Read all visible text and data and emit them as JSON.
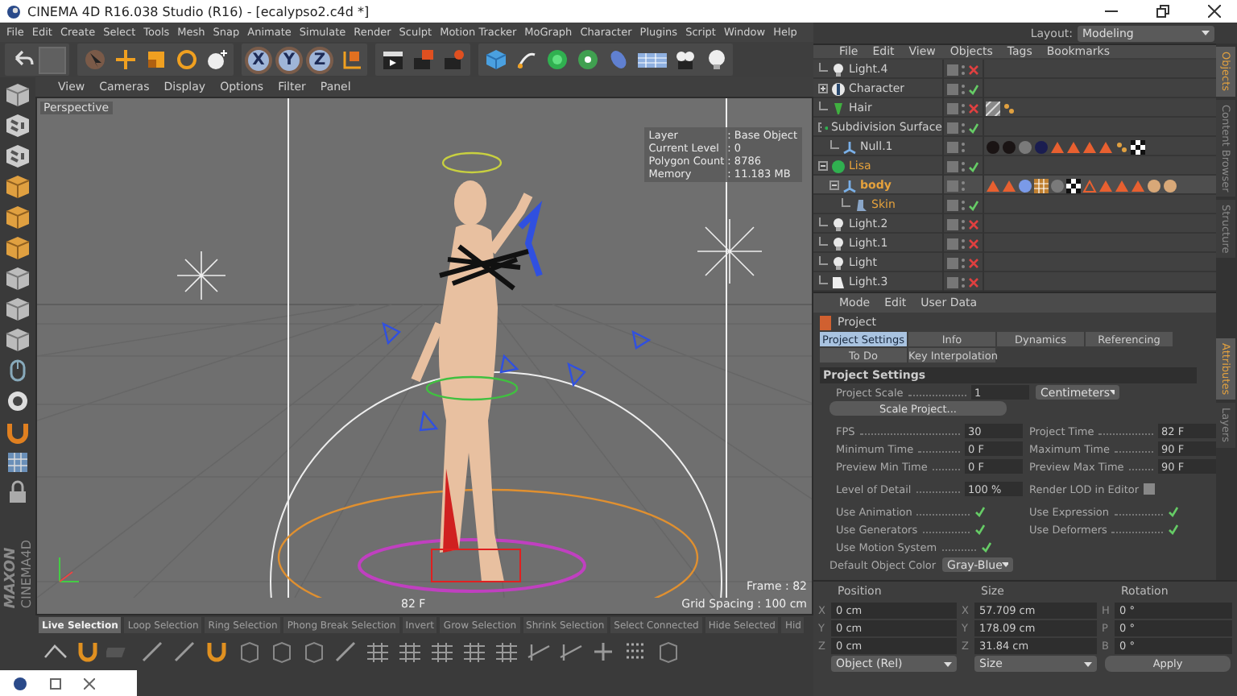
{
  "window": {
    "title": "CINEMA 4D R16.038 Studio (R16) - [ecalypso2.c4d *]"
  },
  "menu": [
    "File",
    "Edit",
    "Create",
    "Select",
    "Tools",
    "Mesh",
    "Snap",
    "Animate",
    "Simulate",
    "Render",
    "Sculpt",
    "Motion Tracker",
    "MoGraph",
    "Character",
    "Plugins",
    "Script",
    "Window",
    "Help"
  ],
  "toolbar": {
    "axis_buttons": [
      {
        "label": "X",
        "selected": true
      },
      {
        "label": "Y",
        "selected": true
      },
      {
        "label": "Z",
        "selected": true
      }
    ]
  },
  "layout": {
    "label": "Layout:",
    "value": "Modeling"
  },
  "viewport": {
    "menu": [
      "View",
      "Cameras",
      "Display",
      "Options",
      "Filter",
      "Panel"
    ],
    "camera": "Perspective",
    "hud": [
      {
        "label": "Layer",
        "value": ": Base Object"
      },
      {
        "label": "Current Level",
        "value": ": 0"
      },
      {
        "label": "Polygon Count",
        "value": ": 8786"
      },
      {
        "label": "Memory",
        "value": ": 11.183 MB"
      }
    ],
    "frame_marker": "82 F",
    "frame": "Frame : 82",
    "grid_spacing": "Grid Spacing : 100 cm"
  },
  "logo": {
    "brand": "MAXON",
    "product": "CINEMA4D"
  },
  "selection_tabs": [
    {
      "label": "Live Selection",
      "selected": true
    },
    {
      "label": "Loop Selection",
      "selected": false
    },
    {
      "label": "Ring Selection",
      "selected": false
    },
    {
      "label": "Phong Break Selection",
      "selected": false
    },
    {
      "label": "Invert",
      "selected": false
    },
    {
      "label": "Grow Selection",
      "selected": false
    },
    {
      "label": "Shrink Selection",
      "selected": false
    },
    {
      "label": "Select Connected",
      "selected": false
    },
    {
      "label": "Hide Selected",
      "selected": false
    },
    {
      "label": "Hid",
      "selected": false
    }
  ],
  "object_manager": {
    "menu": [
      "File",
      "Edit",
      "View",
      "Objects",
      "Tags",
      "Bookmarks"
    ],
    "objects": [
      {
        "name": "Light.4",
        "kind": "light",
        "enabled": false,
        "selected": false,
        "active": false
      },
      {
        "name": "Character",
        "kind": "character",
        "enabled": true,
        "selected": false,
        "active": false,
        "expanded": false
      },
      {
        "name": "Hair",
        "kind": "hair",
        "enabled": false,
        "selected": false,
        "active": false,
        "tags": [
          {
            "kind": "stripes"
          },
          {
            "kind": "dots"
          }
        ]
      },
      {
        "name": "Subdivision Surface",
        "kind": "subdivision",
        "enabled": true,
        "selected": false,
        "active": false,
        "expanded": true,
        "children": [
          {
            "name": "Null.1",
            "kind": "null",
            "selected": false,
            "active": false,
            "tags": [
              {
                "kind": "ball-dark"
              },
              {
                "kind": "ball-dark"
              },
              {
                "kind": "ball-gray"
              },
              {
                "kind": "ball-navy"
              },
              {
                "kind": "triangle"
              },
              {
                "kind": "triangle"
              },
              {
                "kind": "triangle"
              },
              {
                "kind": "triangle"
              },
              {
                "kind": "dots"
              },
              {
                "kind": "checker"
              }
            ]
          }
        ]
      },
      {
        "name": "Lisa",
        "kind": "subdivision",
        "enabled": true,
        "selected": true,
        "active": false,
        "expanded": true,
        "children": [
          {
            "name": "body",
            "kind": "null",
            "selected": true,
            "active": true,
            "expanded": true,
            "tags": [
              {
                "kind": "triangle"
              },
              {
                "kind": "triangle"
              },
              {
                "kind": "ball-blue"
              },
              {
                "kind": "grid"
              },
              {
                "kind": "ball-gray"
              },
              {
                "kind": "checker"
              },
              {
                "kind": "triangle-outline"
              },
              {
                "kind": "triangle"
              },
              {
                "kind": "triangle"
              },
              {
                "kind": "triangle"
              },
              {
                "kind": "ball-skin"
              },
              {
                "kind": "ball-skin"
              }
            ],
            "children": [
              {
                "name": "Skin",
                "kind": "skin",
                "enabled": true,
                "selected": true,
                "active": false
              }
            ]
          }
        ]
      },
      {
        "name": "Light.2",
        "kind": "light",
        "enabled": false,
        "selected": false,
        "active": false
      },
      {
        "name": "Light.1",
        "kind": "light",
        "enabled": false,
        "selected": false,
        "active": false
      },
      {
        "name": "Light",
        "kind": "light",
        "enabled": false,
        "selected": false,
        "active": false
      },
      {
        "name": "Light.3",
        "kind": "spot",
        "enabled": false,
        "selected": false,
        "active": false
      }
    ]
  },
  "side_tabs_top": [
    {
      "label": "Objects",
      "selected": true
    },
    {
      "label": "Content Browser",
      "selected": false
    },
    {
      "label": "Structure",
      "selected": false
    }
  ],
  "side_tabs_bottom": [
    {
      "label": "Attributes",
      "selected": true
    },
    {
      "label": "Layers",
      "selected": false
    }
  ],
  "attributes": {
    "menu": [
      "Mode",
      "Edit",
      "User Data"
    ],
    "title": "Project",
    "tabs": [
      {
        "label": "Project Settings",
        "selected": true
      },
      {
        "label": "Info",
        "selected": false
      },
      {
        "label": "Dynamics",
        "selected": false
      },
      {
        "label": "Referencing",
        "selected": false
      },
      {
        "label": "To Do",
        "selected": false
      },
      {
        "label": "Key Interpolation",
        "selected": false
      }
    ],
    "section": "Project Settings",
    "scale": {
      "label": "Project Scale",
      "value": "1",
      "unit": "Centimeters"
    },
    "scale_button": "Scale Project...",
    "time_fields": [
      {
        "label": "FPS",
        "value": "30"
      },
      {
        "label": "Project Time",
        "value": "82 F"
      },
      {
        "label": "Minimum Time",
        "value": "0 F"
      },
      {
        "label": "Maximum Time",
        "value": "90 F"
      },
      {
        "label": "Preview Min Time",
        "value": "0 F"
      },
      {
        "label": "Preview Max Time",
        "value": "90 F"
      }
    ],
    "detail": {
      "label": "Level of Detail",
      "value": "100 %"
    },
    "render_lod": {
      "label": "Render LOD in Editor",
      "checked": false
    },
    "options": [
      {
        "label": "Use Animation",
        "checked": true
      },
      {
        "label": "Use Expression",
        "checked": true
      },
      {
        "label": "Use Generators",
        "checked": true
      },
      {
        "label": "Use Deformers",
        "checked": true
      },
      {
        "label": "Use Motion System",
        "checked": true
      }
    ],
    "default_color": {
      "label": "Default Object Color",
      "value": "Gray-Blue"
    }
  },
  "coordinates": {
    "headers": [
      "Position",
      "Size",
      "Rotation"
    ],
    "rows": [
      [
        {
          "axis": "X",
          "value": "0 cm"
        },
        {
          "axis": "X",
          "value": "57.709 cm"
        },
        {
          "axis": "H",
          "value": "0 °"
        }
      ],
      [
        {
          "axis": "Y",
          "value": "0 cm"
        },
        {
          "axis": "Y",
          "value": "178.09 cm"
        },
        {
          "axis": "P",
          "value": "0 °"
        }
      ],
      [
        {
          "axis": "Z",
          "value": "0 cm"
        },
        {
          "axis": "Z",
          "value": "31.84 cm"
        },
        {
          "axis": "B",
          "value": "0 °"
        }
      ]
    ],
    "mode": "Object (Rel)",
    "size_mode": "Size",
    "apply": "Apply"
  }
}
